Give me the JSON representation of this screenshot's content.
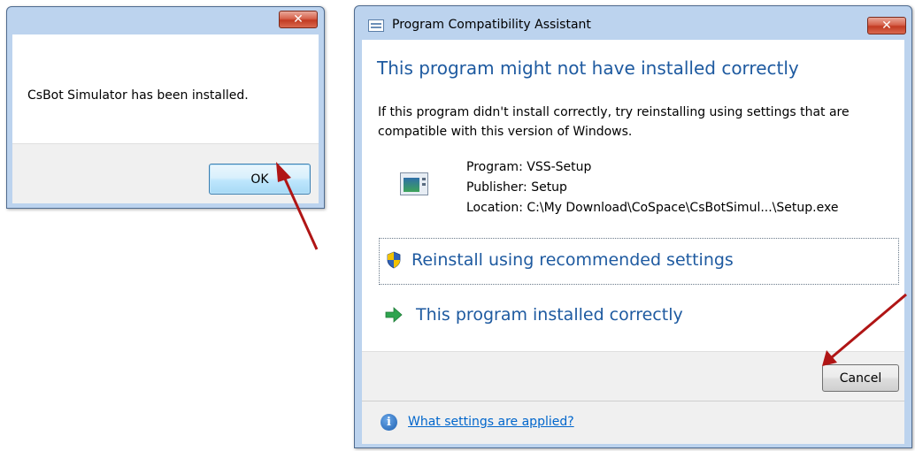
{
  "left_dialog": {
    "close_glyph": "✕",
    "message": "CsBot Simulator has been installed.",
    "ok_label": "OK"
  },
  "pca_dialog": {
    "title": "Program Compatibility Assistant",
    "close_glyph": "✕",
    "heading": "This program might not have installed correctly",
    "description": "If this program didn't install correctly, try reinstalling using settings that are compatible with this version of Windows.",
    "program_label": "Program: VSS-Setup",
    "publisher_label": "Publisher: Setup",
    "location_label": "Location: C:\\My Download\\CoSpace\\CsBotSimul...\\Setup.exe",
    "option_reinstall": "Reinstall using recommended settings",
    "option_installed_correctly": "This program installed correctly",
    "cancel_label": "Cancel",
    "footer_link": "What settings are applied?",
    "info_glyph": "i"
  },
  "colors": {
    "heading_blue": "#1e5aa0",
    "link_blue": "#0066cc",
    "annotation_arrow": "#b01515",
    "green_arrow": "#2fa44f"
  }
}
